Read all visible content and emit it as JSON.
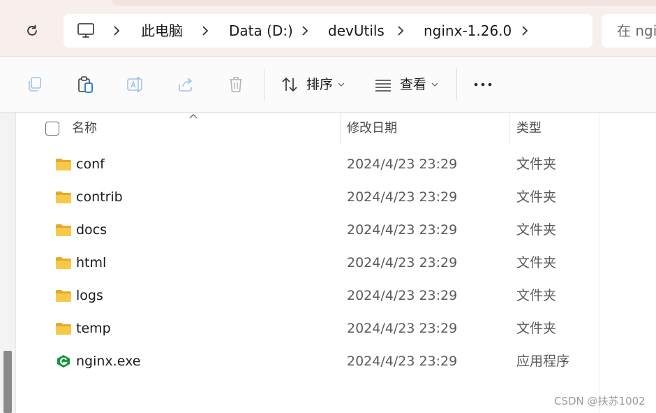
{
  "breadcrumb": {
    "items": [
      "此电脑",
      "Data (D:)",
      "devUtils",
      "nginx-1.26.0"
    ]
  },
  "search": {
    "placeholder": "在 ngi"
  },
  "toolbar": {
    "sort_label": "排序",
    "view_label": "查看"
  },
  "columns": {
    "name": "名称",
    "modified": "修改日期",
    "type": "类型"
  },
  "files": [
    {
      "name": "conf",
      "modified": "2024/4/23 23:29",
      "type": "文件夹",
      "icon": "folder-icon"
    },
    {
      "name": "contrib",
      "modified": "2024/4/23 23:29",
      "type": "文件夹",
      "icon": "folder-icon"
    },
    {
      "name": "docs",
      "modified": "2024/4/23 23:29",
      "type": "文件夹",
      "icon": "folder-icon"
    },
    {
      "name": "html",
      "modified": "2024/4/23 23:29",
      "type": "文件夹",
      "icon": "folder-icon"
    },
    {
      "name": "logs",
      "modified": "2024/4/23 23:29",
      "type": "文件夹",
      "icon": "folder-icon"
    },
    {
      "name": "temp",
      "modified": "2024/4/23 23:29",
      "type": "文件夹",
      "icon": "folder-icon"
    },
    {
      "name": "nginx.exe",
      "modified": "2024/4/23 23:29",
      "type": "应用程序",
      "icon": "nginx-app-icon"
    }
  ],
  "watermark": "CSDN @扶苏1002",
  "colors": {
    "folder": "#f7c948",
    "folder_dark": "#e7a92b",
    "nginx_green": "#119639",
    "address_bg": "#f8efec"
  }
}
